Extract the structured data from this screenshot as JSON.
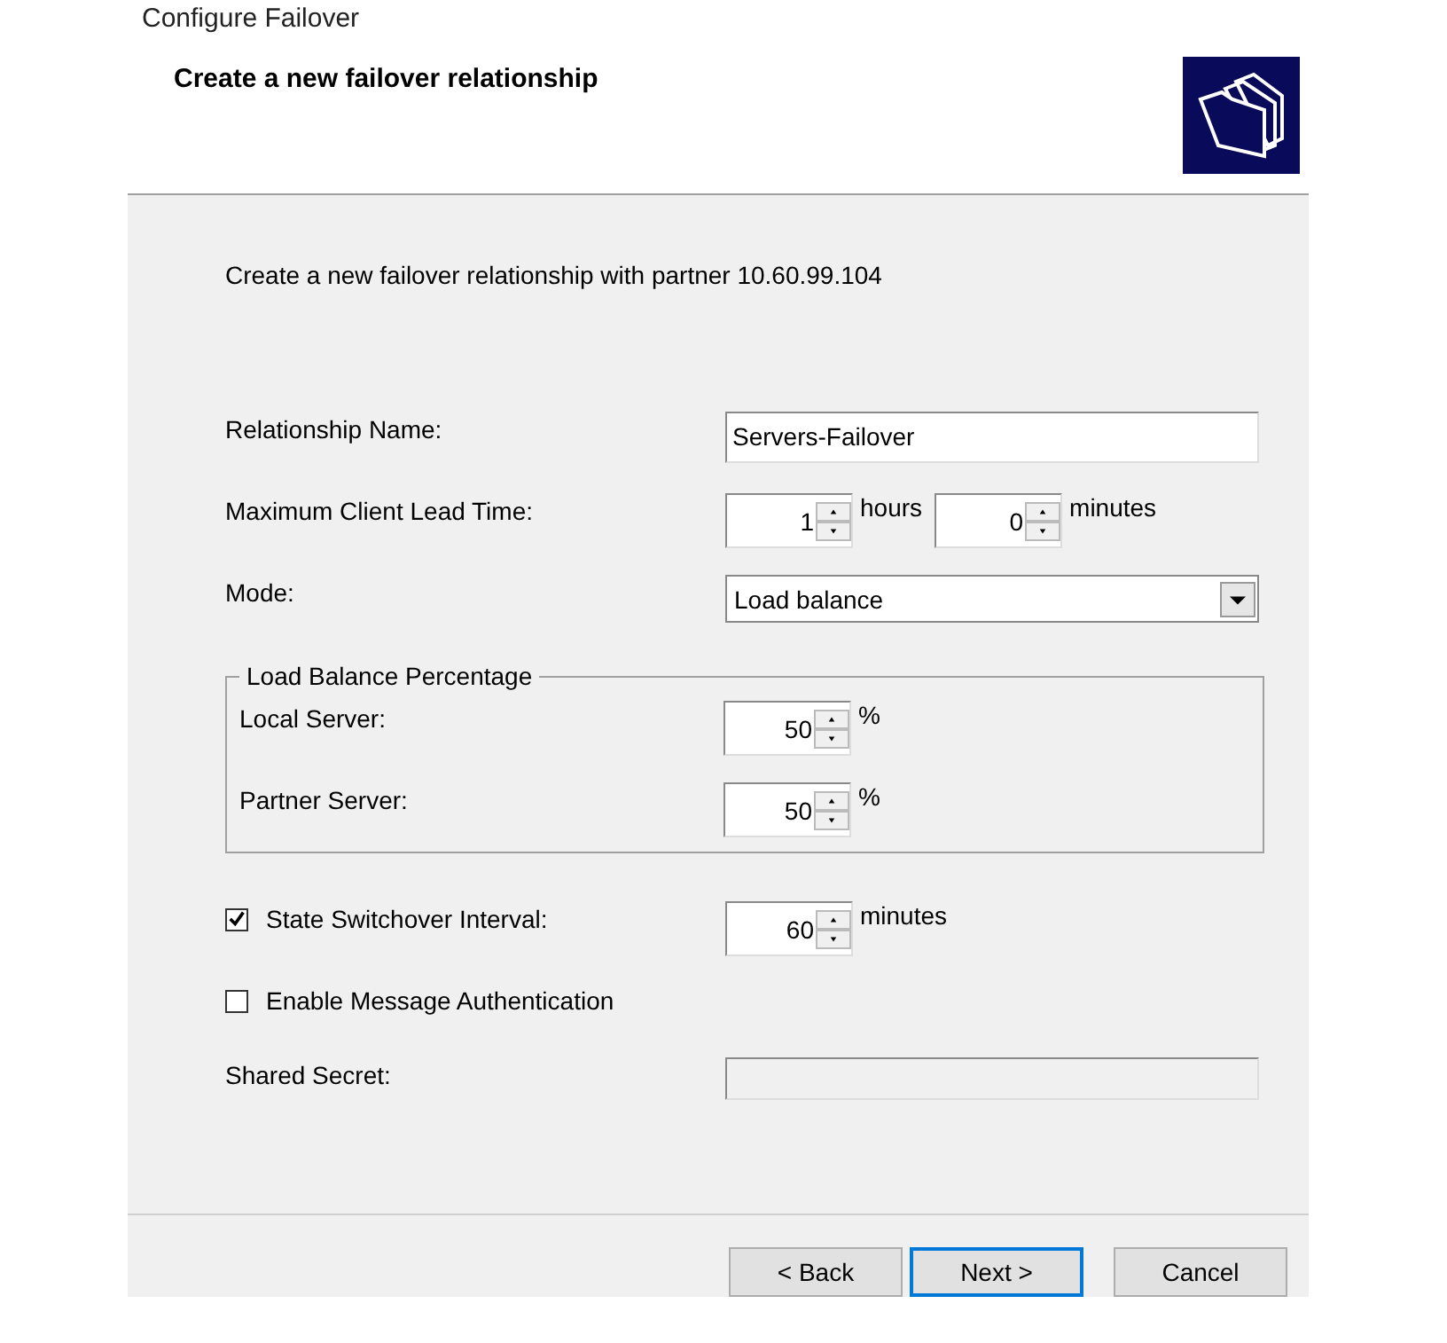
{
  "window": {
    "title": "Configure Failover"
  },
  "header": {
    "title": "Create a new failover relationship"
  },
  "intro": "Create a new failover relationship with partner 10.60.99.104",
  "relationship_name": {
    "label": "Relationship Name:",
    "value": "Servers-Failover"
  },
  "max_client_lead_time": {
    "label": "Maximum Client Lead Time:",
    "hours": {
      "value": "1",
      "unit": "hours"
    },
    "minutes": {
      "value": "0",
      "unit": "minutes"
    }
  },
  "mode": {
    "label": "Mode:",
    "value": "Load balance"
  },
  "load_balance": {
    "title": "Load Balance Percentage",
    "rows": [
      {
        "label": "Local Server:",
        "value": "50",
        "unit": "%"
      },
      {
        "label": "Partner Server:",
        "value": "50",
        "unit": "%"
      }
    ]
  },
  "state_switchover": {
    "label": "State Switchover Interval:",
    "checked": true,
    "value": "60",
    "unit": "minutes"
  },
  "message_auth": {
    "label": "Enable Message Authentication",
    "checked": false
  },
  "shared_secret": {
    "label": "Shared Secret:",
    "disabled": true
  },
  "buttons": [
    {
      "label": "< Back",
      "default": false
    },
    {
      "label": "Next >",
      "default": true
    },
    {
      "label": "Cancel",
      "default": false
    }
  ]
}
